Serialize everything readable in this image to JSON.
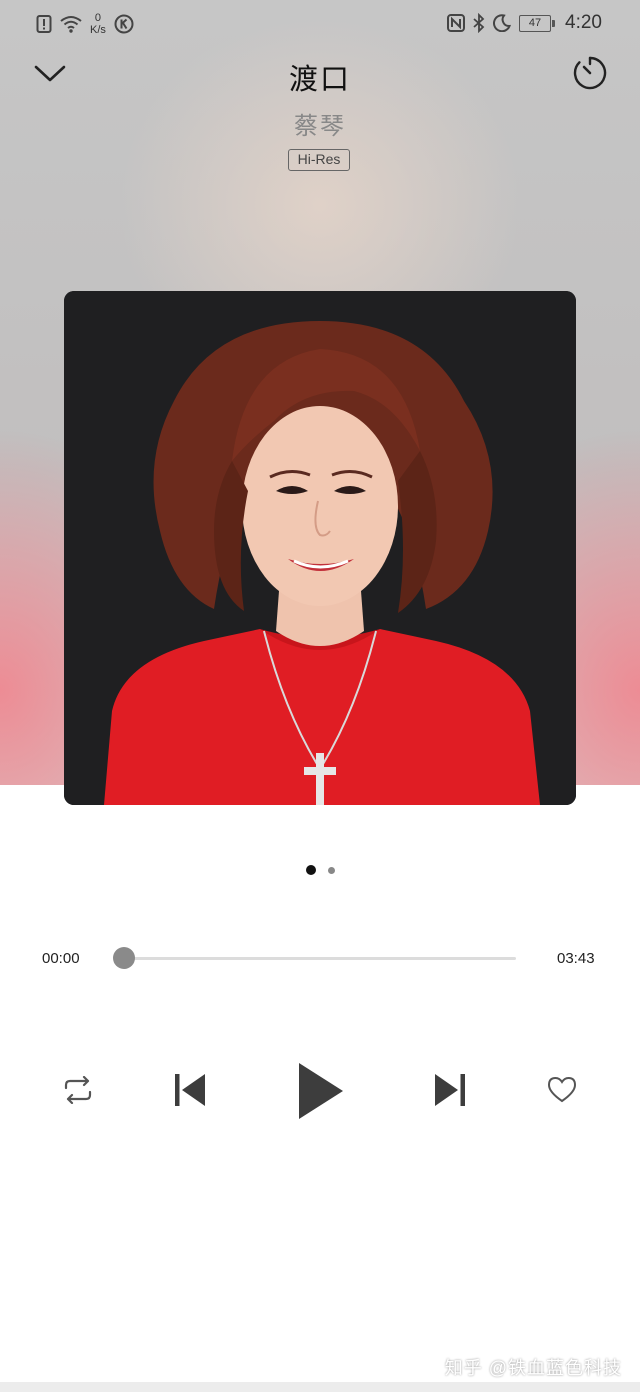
{
  "status_bar": {
    "network_speed_value": "0",
    "network_speed_unit": "K/s",
    "battery_level": "47",
    "time": "4:20"
  },
  "song": {
    "title": "渡口",
    "artist": "蔡琴",
    "quality_badge": "Hi-Res"
  },
  "pager": {
    "current_page": 1,
    "page_count": 2
  },
  "playback": {
    "current_time": "00:00",
    "total_time": "03:43",
    "progress_fraction": 0.0
  },
  "icons": {
    "collapse": "chevron-down-icon",
    "timer": "sleep-timer-icon",
    "repeat": "repeat-icon",
    "previous": "skip-previous-icon",
    "play": "play-icon",
    "next": "skip-next-icon",
    "favorite": "heart-icon"
  },
  "colors": {
    "controls": "#3d3d3d",
    "progress_thumb": "#8a8a8a",
    "cover_background": "#1f1f21",
    "sweater": "#e01d24"
  },
  "watermark": "知乎 @铁血蓝色科技"
}
